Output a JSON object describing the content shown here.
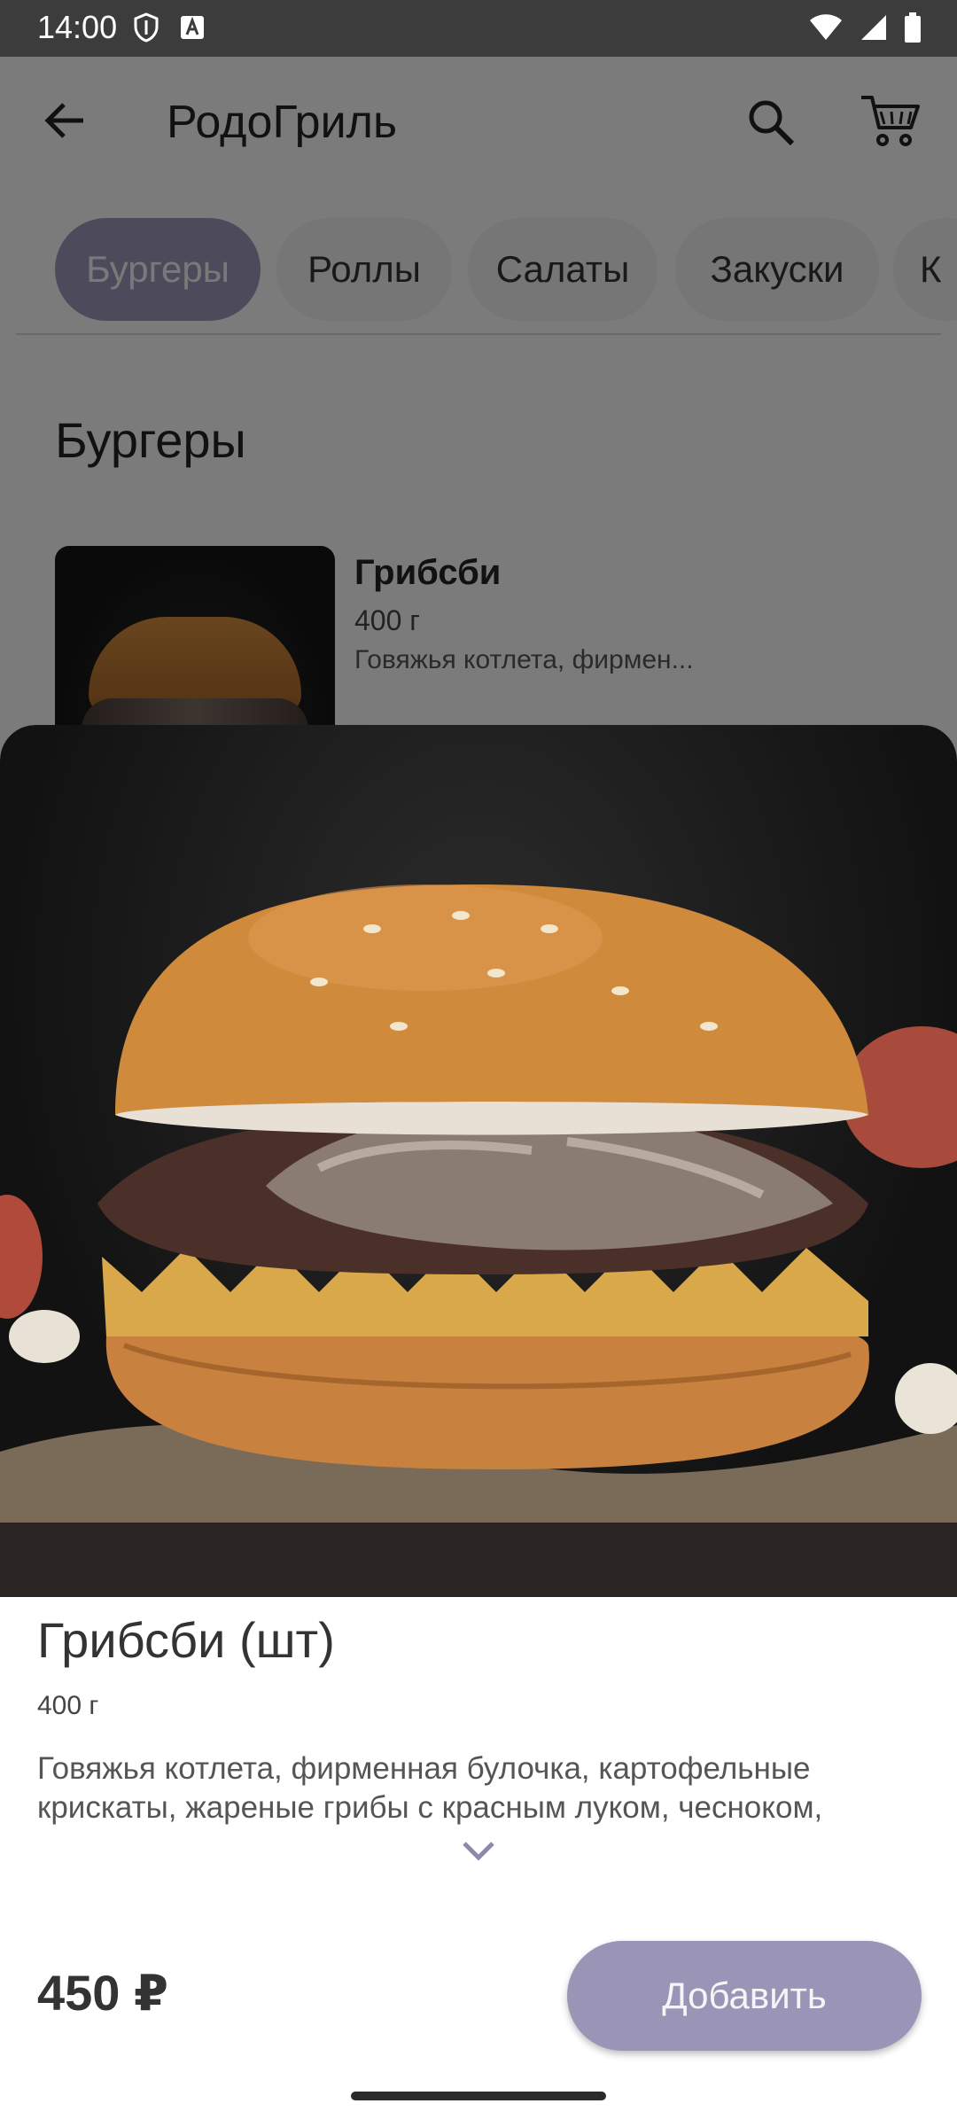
{
  "status": {
    "time": "14:00"
  },
  "topbar": {
    "title": "РодоГриль"
  },
  "categories": [
    {
      "label": "Бургеры"
    },
    {
      "label": "Роллы"
    },
    {
      "label": "Салаты"
    },
    {
      "label": "Закуски"
    },
    {
      "label": "К"
    }
  ],
  "section": {
    "title": "Бургеры"
  },
  "list_item": {
    "name": "Грибсби",
    "weight": "400 г",
    "desc": "Говяжья котлета, фирмен..."
  },
  "product": {
    "title": "Грибсби (шт)",
    "weight": "400 г",
    "description": "Говяжья котлета, фирменная булочка, картофельные крискаты, жареные грибы с красным луком, чесноком,",
    "price": "450 ₽",
    "add_label": "Добавить"
  },
  "colors": {
    "accent": "#9a95b6"
  }
}
